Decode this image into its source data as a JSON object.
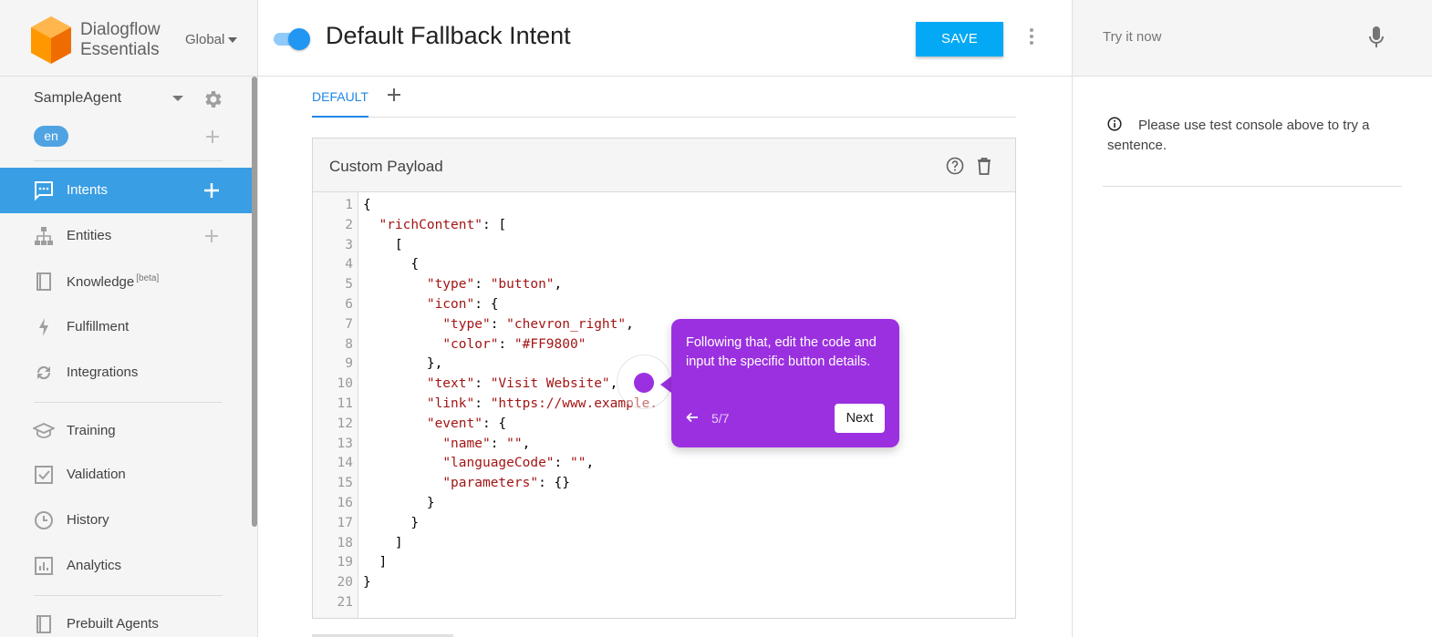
{
  "brand": {
    "line1": "Dialogflow",
    "line2": "Essentials",
    "region": "Global"
  },
  "agent": {
    "name": "SampleAgent",
    "language": "en"
  },
  "nav": [
    {
      "label": "Intents",
      "icon": "chat-icon",
      "has_add": true,
      "active": true
    },
    {
      "label": "Entities",
      "icon": "hierarchy-icon",
      "has_add": true
    },
    {
      "label": "Knowledge",
      "icon": "book-icon",
      "badge": "[beta]"
    },
    {
      "label": "Fulfillment",
      "icon": "bolt-icon"
    },
    {
      "label": "Integrations",
      "icon": "sync-icon"
    },
    {
      "label": "Training",
      "icon": "graduation-cap-icon"
    },
    {
      "label": "Validation",
      "icon": "check-box-icon"
    },
    {
      "label": "History",
      "icon": "clock-icon"
    },
    {
      "label": "Analytics",
      "icon": "bar-chart-icon"
    },
    {
      "label": "Prebuilt Agents",
      "icon": "book-icon"
    }
  ],
  "header": {
    "title": "Default Fallback Intent",
    "save_label": "SAVE",
    "toggle_on": true
  },
  "tabs": {
    "default_label": "DEFAULT"
  },
  "card": {
    "title": "Custom Payload"
  },
  "code_lines": [
    "{",
    "  \"richContent\": [",
    "    [",
    "      {",
    "        \"type\": \"button\",",
    "        \"icon\": {",
    "          \"type\": \"chevron_right\",",
    "          \"color\": \"#FF9800\"",
    "        },",
    "        \"text\": \"Visit Website\",",
    "        \"link\": \"https://www.example.",
    "        \"event\": {",
    "          \"name\": \"\",",
    "          \"languageCode\": \"\",",
    "          \"parameters\": {}",
    "        }",
    "      }",
    "    ]",
    "  ]",
    "}",
    ""
  ],
  "tooltip": {
    "text": "Following that, edit the code and input the specific button details.",
    "step": "5/7",
    "next_label": "Next"
  },
  "test_console": {
    "placeholder": "Try it now",
    "info": "Please use test console above to try a sentence."
  },
  "colors": {
    "accent": "#3a9ee4",
    "save": "#03a9f4",
    "tour": "#9b30e0",
    "string": "#a31515"
  }
}
